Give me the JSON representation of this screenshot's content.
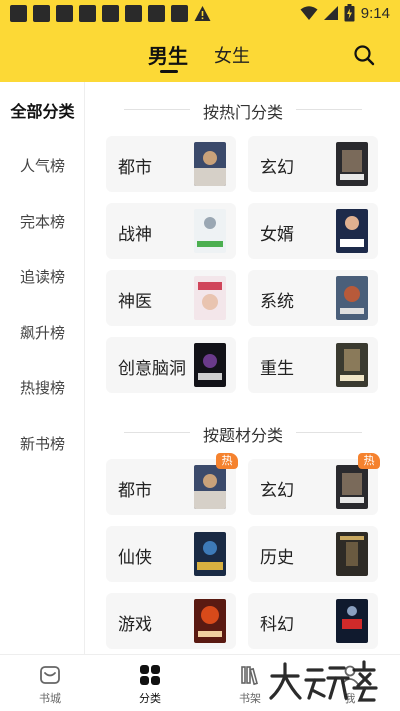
{
  "status_bar": {
    "time": "9:14"
  },
  "header": {
    "tabs": [
      {
        "label": "男生",
        "active": true
      },
      {
        "label": "女生",
        "active": false
      }
    ],
    "search_icon": "search-icon"
  },
  "sidebar": {
    "items": [
      {
        "label": "全部分类",
        "active": true
      },
      {
        "label": "人气榜"
      },
      {
        "label": "完本榜"
      },
      {
        "label": "追读榜"
      },
      {
        "label": "飙升榜"
      },
      {
        "label": "热搜榜"
      },
      {
        "label": "新书榜"
      }
    ]
  },
  "sections": [
    {
      "title": "按热门分类",
      "cards": [
        {
          "label": "都市",
          "hot": false
        },
        {
          "label": "玄幻",
          "hot": false
        },
        {
          "label": "战神",
          "hot": false
        },
        {
          "label": "女婿",
          "hot": false
        },
        {
          "label": "神医",
          "hot": false
        },
        {
          "label": "系统",
          "hot": false
        },
        {
          "label": "创意脑洞",
          "hot": false
        },
        {
          "label": "重生",
          "hot": false
        }
      ]
    },
    {
      "title": "按题材分类",
      "cards": [
        {
          "label": "都市",
          "hot": true,
          "badge": "热"
        },
        {
          "label": "玄幻",
          "hot": true,
          "badge": "热"
        },
        {
          "label": "仙侠",
          "hot": false
        },
        {
          "label": "历史",
          "hot": false
        },
        {
          "label": "游戏",
          "hot": false
        },
        {
          "label": "科幻",
          "hot": false
        }
      ]
    }
  ],
  "bottom_nav": {
    "items": [
      {
        "label": "书城",
        "icon": "bookstore-icon",
        "active": false
      },
      {
        "label": "分类",
        "icon": "category-grid-icon",
        "active": true
      },
      {
        "label": "书架",
        "icon": "bookshelf-icon",
        "active": false
      },
      {
        "label": "我",
        "icon": "profile-icon",
        "active": false
      }
    ]
  },
  "colors": {
    "header_bg": "#fcd936",
    "card_bg": "#f6f6f6",
    "hot_badge": "#f5822e"
  }
}
